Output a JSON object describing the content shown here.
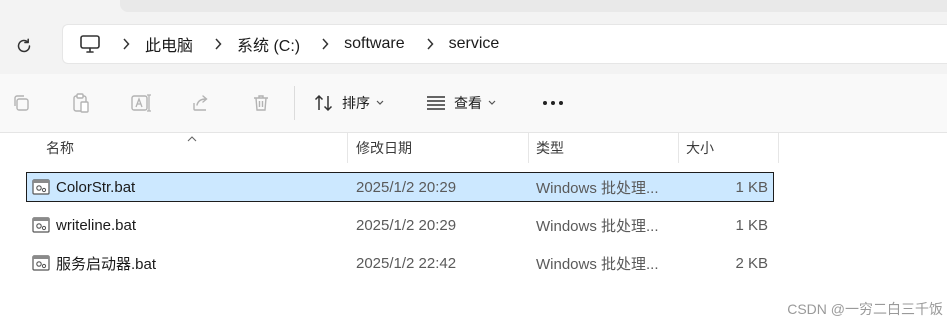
{
  "breadcrumb": [
    "此电脑",
    "系统 (C:)",
    "software",
    "service"
  ],
  "toolbar": {
    "sort_label": "排序",
    "view_label": "查看",
    "more_label": "•••"
  },
  "columns": {
    "name": "名称",
    "date": "修改日期",
    "type": "类型",
    "size": "大小"
  },
  "files": [
    {
      "name": "ColorStr.bat",
      "date": "2025/1/2 20:29",
      "type": "Windows 批处理...",
      "size": "1 KB",
      "selected": true
    },
    {
      "name": "writeline.bat",
      "date": "2025/1/2 20:29",
      "type": "Windows 批处理...",
      "size": "1 KB",
      "selected": false
    },
    {
      "name": "服务启动器.bat",
      "date": "2025/1/2 22:42",
      "type": "Windows 批处理...",
      "size": "2 KB",
      "selected": false
    }
  ],
  "colors": {
    "selection": "#cce8ff",
    "chrome": "#f3f3f3"
  },
  "watermark": "CSDN @一穷二白三千饭"
}
